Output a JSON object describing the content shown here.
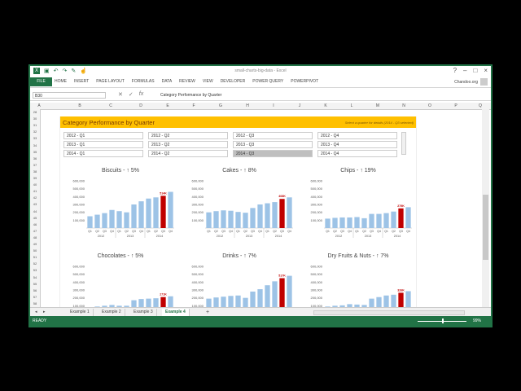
{
  "window": {
    "title": "small-charts-big-data - Excel",
    "win_buttons": [
      "?",
      "–",
      "□",
      "×"
    ],
    "qa_icons": [
      "excel-logo-icon",
      "save-icon",
      "undo-icon",
      "redo-icon",
      "paint-icon",
      "touch-mode-icon"
    ]
  },
  "ribbon": {
    "file_tab": "FILE",
    "tabs": [
      "HOME",
      "INSERT",
      "PAGE LAYOUT",
      "FORMULAS",
      "DATA",
      "REVIEW",
      "VIEW",
      "DEVELOPER",
      "POWER QUERY",
      "POWERPIVOT"
    ],
    "user": "Chandoo.org"
  },
  "formula_bar": {
    "cell": "B30",
    "fx": "fx",
    "value": "Category Performance by Quarter"
  },
  "columns": [
    "A",
    "B",
    "C",
    "D",
    "E",
    "F",
    "G",
    "H",
    "I",
    "J",
    "K",
    "L",
    "M",
    "N",
    "O",
    "P",
    "Q"
  ],
  "rows": [
    "28",
    "30",
    "31",
    "32",
    "33",
    "34",
    "35",
    "36",
    "37",
    "38",
    "39",
    "40",
    "41",
    "42",
    "43",
    "44",
    "45",
    "46",
    "47",
    "48",
    "49",
    "50",
    "51",
    "52",
    "53",
    "54",
    "55",
    "56",
    "57",
    "58"
  ],
  "dashboard": {
    "title": "Category Performance by Quarter",
    "hint": "Select a quarter for details (2014 - Q3 selected)",
    "slicer": [
      [
        "2012 - Q1",
        "2012 - Q2",
        "2012 - Q3",
        "2012 - Q4"
      ],
      [
        "2013 - Q1",
        "2013 - Q2",
        "2013 - Q3",
        "2013 - Q4"
      ],
      [
        "2014 - Q1",
        "2014 - Q2",
        "2014 - Q3",
        "2014 - Q4"
      ]
    ],
    "selected": "2014 - Q3"
  },
  "chart_data": [
    {
      "type": "bar",
      "title": "Biscuits - ↑ 5%",
      "yticks": [
        "600,000",
        "500,000",
        "400,000",
        "300,000",
        "200,000",
        "100,000"
      ],
      "ylim": [
        0,
        600000
      ],
      "categories": [
        "Q1",
        "Q2",
        "Q3",
        "Q4",
        "Q1",
        "Q2",
        "Q3",
        "Q4",
        "Q1",
        "Q2",
        "Q3",
        "Q4"
      ],
      "years": [
        "2012",
        "2013",
        "2014"
      ],
      "values": [
        150000,
        170000,
        190000,
        230000,
        215000,
        200000,
        300000,
        340000,
        375000,
        390000,
        410000,
        460000
      ],
      "highlight_index": 10,
      "highlight_label": "514K",
      "colors": {
        "bar": "#9dc3e6",
        "highlight": "#c00000"
      }
    },
    {
      "type": "bar",
      "title": "Cakes - ↑ 8%",
      "yticks": [
        "600,000",
        "500,000",
        "400,000",
        "300,000",
        "200,000",
        "100,000"
      ],
      "ylim": [
        0,
        600000
      ],
      "categories": [
        "Q1",
        "Q2",
        "Q3",
        "Q4",
        "Q1",
        "Q2",
        "Q3",
        "Q4",
        "Q1",
        "Q2",
        "Q3",
        "Q4"
      ],
      "years": [
        "2012",
        "2013",
        "2014"
      ],
      "values": [
        200000,
        215000,
        225000,
        220000,
        205000,
        195000,
        255000,
        300000,
        315000,
        330000,
        370000,
        390000
      ],
      "highlight_index": 10,
      "highlight_label": "408K",
      "colors": {
        "bar": "#9dc3e6",
        "highlight": "#c00000"
      }
    },
    {
      "type": "bar",
      "title": "Chips - ↑ 19%",
      "yticks": [
        "600,000",
        "500,000",
        "400,000",
        "300,000",
        "200,000",
        "100,000"
      ],
      "ylim": [
        0,
        600000
      ],
      "categories": [
        "Q1",
        "Q2",
        "Q3",
        "Q4",
        "Q1",
        "Q2",
        "Q3",
        "Q4",
        "Q1",
        "Q2",
        "Q3",
        "Q4"
      ],
      "years": [
        "2012",
        "2013",
        "2014"
      ],
      "values": [
        120000,
        130000,
        135000,
        135000,
        140000,
        125000,
        180000,
        180000,
        190000,
        210000,
        250000,
        265000
      ],
      "highlight_index": 10,
      "highlight_label": "279K",
      "colors": {
        "bar": "#9dc3e6",
        "highlight": "#c00000"
      }
    },
    {
      "type": "bar",
      "title": "Chocolates - ↑ 5%",
      "yticks": [
        "600,000",
        "500,000",
        "400,000",
        "300,000",
        "200,000",
        "100,000"
      ],
      "ylim": [
        0,
        600000
      ],
      "categories": [
        "Q1",
        "Q2",
        "Q3",
        "Q4",
        "Q1",
        "Q2",
        "Q3",
        "Q4",
        "Q1",
        "Q2",
        "Q3",
        "Q4"
      ],
      "years": [
        "2012",
        "2013",
        "2014"
      ],
      "values": [
        80000,
        90000,
        100000,
        110000,
        100000,
        100000,
        170000,
        185000,
        190000,
        195000,
        210000,
        220000
      ],
      "highlight_index": 10,
      "highlight_label": "271K",
      "colors": {
        "bar": "#9dc3e6",
        "highlight": "#c00000"
      }
    },
    {
      "type": "bar",
      "title": "Drinks - ↑ 7%",
      "yticks": [
        "600,000",
        "500,000",
        "400,000",
        "300,000",
        "200,000",
        "100,000"
      ],
      "ylim": [
        0,
        600000
      ],
      "categories": [
        "Q1",
        "Q2",
        "Q3",
        "Q4",
        "Q1",
        "Q2",
        "Q3",
        "Q4",
        "Q1",
        "Q2",
        "Q3",
        "Q4"
      ],
      "years": [
        "2012",
        "2013",
        "2014"
      ],
      "values": [
        190000,
        205000,
        215000,
        225000,
        230000,
        200000,
        280000,
        310000,
        360000,
        410000,
        450000,
        480000
      ],
      "highlight_index": 10,
      "highlight_label": "517K",
      "colors": {
        "bar": "#9dc3e6",
        "highlight": "#c00000"
      }
    },
    {
      "type": "bar",
      "title": "Dry Fruits & Nuts - ↑ 7%",
      "yticks": [
        "600,000",
        "500,000",
        "400,000",
        "300,000",
        "200,000",
        "100,000"
      ],
      "ylim": [
        0,
        600000
      ],
      "categories": [
        "Q1",
        "Q2",
        "Q3",
        "Q4",
        "Q1",
        "Q2",
        "Q3",
        "Q4",
        "Q1",
        "Q2",
        "Q3",
        "Q4"
      ],
      "years": [
        "2012",
        "2013",
        "2014"
      ],
      "values": [
        90000,
        100000,
        105000,
        120000,
        115000,
        110000,
        190000,
        210000,
        230000,
        240000,
        265000,
        285000
      ],
      "highlight_index": 10,
      "highlight_label": "326K",
      "colors": {
        "bar": "#9dc3e6",
        "highlight": "#c00000"
      }
    }
  ],
  "sheet_tabs": [
    "Example 1",
    "Example 2",
    "Example 3",
    "Example 4"
  ],
  "active_sheet": "Example 4",
  "add_sheet": "+",
  "status": {
    "ready": "READY",
    "zoom": "99%"
  }
}
